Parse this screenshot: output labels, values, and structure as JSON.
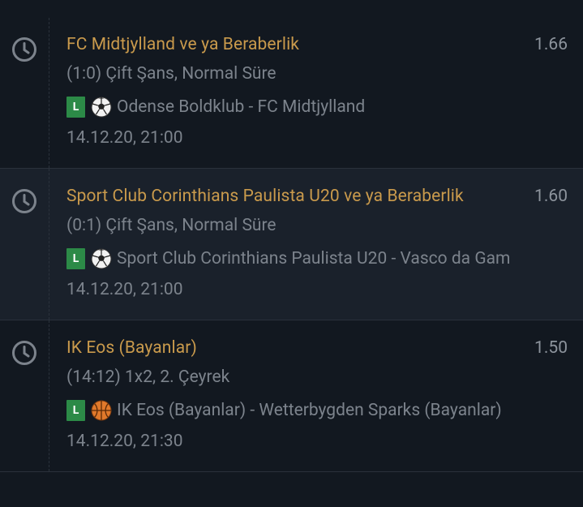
{
  "bets": [
    {
      "title": "FC Midtjylland ve ya Beraberlik",
      "odds": "1.66",
      "market": "(1:0) Çift Şans, Normal Süre",
      "live_badge": "L",
      "sport_icon": "soccer-ball-icon",
      "event": "Odense Boldklub - FC Midtjylland",
      "date": "14.12.20, 21:00"
    },
    {
      "title": "Sport Club Corinthians Paulista U20 ve ya Beraberlik",
      "odds": "1.60",
      "market": "(0:1) Çift Şans, Normal Süre",
      "live_badge": "L",
      "sport_icon": "soccer-ball-icon",
      "event": "Sport Club Corinthians Paulista U20 - Vasco da Gam",
      "date": "14.12.20, 21:00"
    },
    {
      "title": "IK Eos (Bayanlar)",
      "odds": "1.50",
      "market": "(14:12) 1x2, 2. Çeyrek",
      "live_badge": "L",
      "sport_icon": "basketball-icon",
      "event": "IK Eos (Bayanlar) - Wetterbygden Sparks (Bayanlar)",
      "date": "14.12.20, 21:30"
    }
  ],
  "colors": {
    "title": "#c99a4c",
    "live_badge": "#2c8a47",
    "text_muted": "#7c838c",
    "background": "#121820",
    "highlight_background": "#1a212b"
  }
}
